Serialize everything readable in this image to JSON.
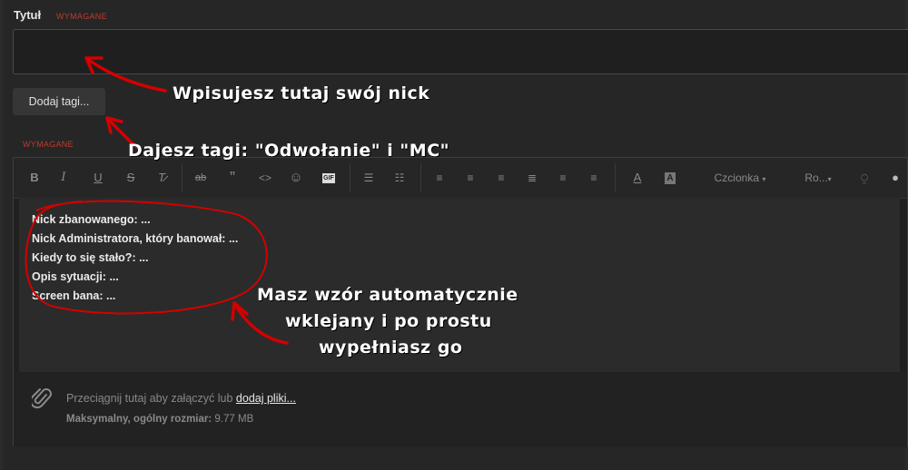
{
  "form": {
    "title_label": "Tytuł",
    "required_label": "WYMAGANE",
    "title_value": "",
    "tags_button": "Dodaj tagi...",
    "editor_required_label": "WYMAGANE"
  },
  "toolbar": {
    "items": [
      "bold-icon",
      "italic-icon",
      "underline-icon",
      "strikethrough-icon",
      "clear-format-icon",
      "code-inline-icon",
      "quote-icon",
      "code-icon",
      "emoji-icon",
      "gif-icon",
      "list-bullet-icon",
      "list-numbered-icon",
      "align-left-icon",
      "align-center-icon",
      "align-right-icon",
      "align-justify-icon",
      "undo-icon",
      "font-color-icon",
      "background-color-icon",
      "font-dropdown",
      "size-dropdown",
      "preview-icon",
      "eye-icon"
    ],
    "gif_label": "GIF",
    "font_label": "Czcionka",
    "size_label": "Ro..."
  },
  "editor": {
    "lines": [
      "Nick zbanowanego: ...",
      "Nick Administratora, który banował: ...",
      "Kiedy to się stało?: ...",
      "Opis sytuacji: ...",
      "Screen bana: ..."
    ]
  },
  "attachments": {
    "prompt": "Przeciągnij tutaj aby załączyć lub",
    "link": "dodaj pliki...",
    "max_label": "Maksymalny, ogólny rozmiar:",
    "max_value": "9.77 MB"
  },
  "annotations": {
    "nick": "Wpisujesz tutaj swój nick",
    "tags": "Dajesz tagi: \"Odwołanie\" i \"MC\"",
    "template_1": "Masz wzór automatycznie",
    "template_2": "wklejany i po prostu",
    "template_3": "wypełniasz go",
    "color": "#d00000"
  }
}
